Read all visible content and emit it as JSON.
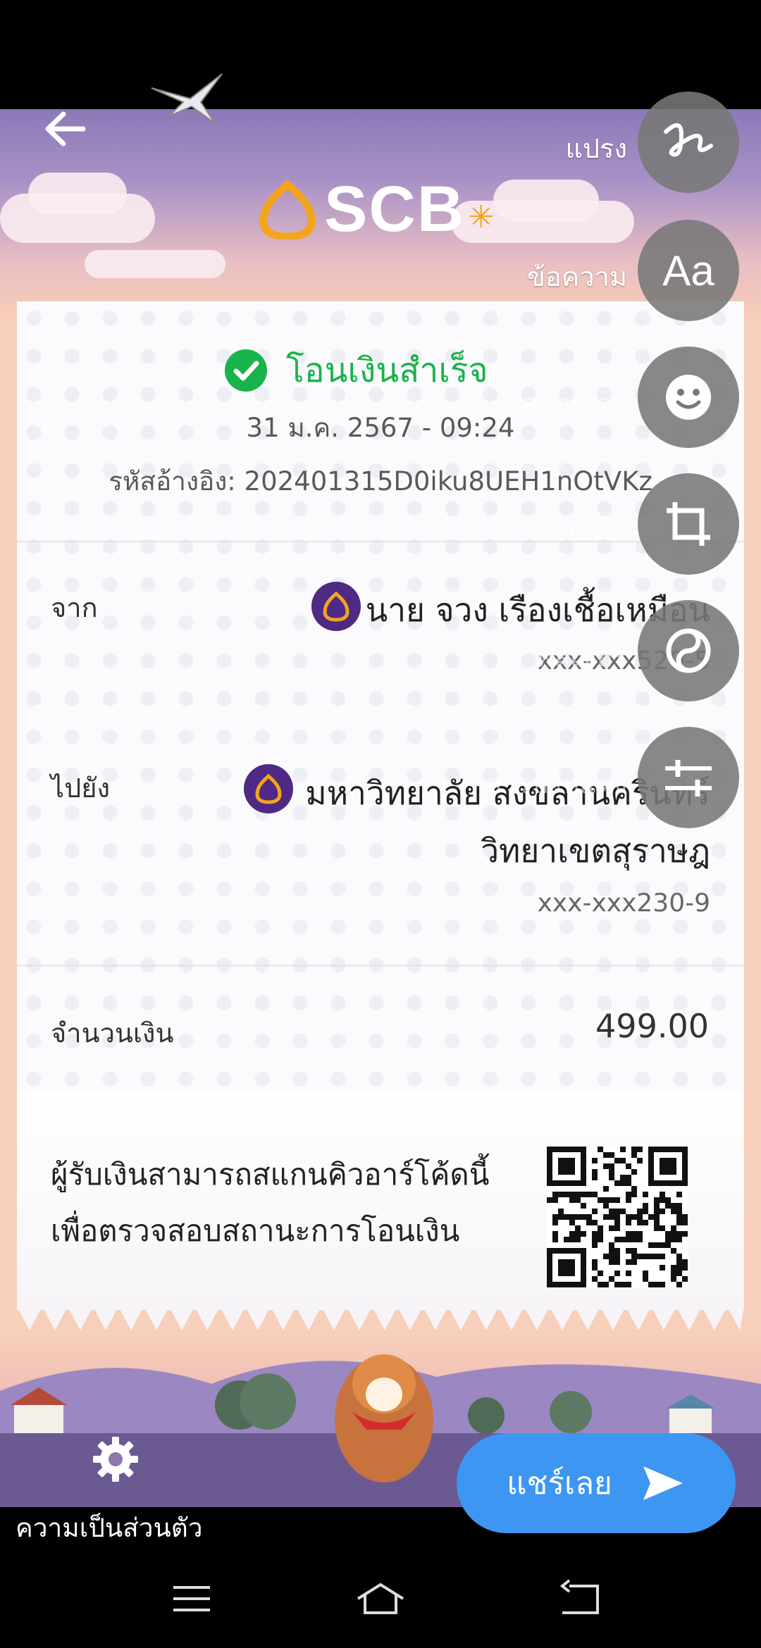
{
  "header": {
    "logo_text": "SCB"
  },
  "receipt": {
    "status": "โอนเงินสำเร็จ",
    "datetime": "31 ม.ค. 2567 - 09:24",
    "reference": "รหัสอ้างอิง: 202401315D0iku8UEH1nOtVKz",
    "from": {
      "label": "จาก",
      "name": "นาย จวง เรืองเชื้อเหมือน",
      "account": "xxx-xxx520-5"
    },
    "to": {
      "label": "ไปยัง",
      "name_line1": "มหาวิทยาลัย สงขลานครินทร์",
      "name_line2": "วิทยาเขตสุราษฎ",
      "account": "xxx-xxx230-9"
    },
    "amount": {
      "label": "จำนวนเงิน",
      "value": "499.00"
    },
    "qr_message_line1": "ผู้รับเงินสามารถสแกนคิวอาร์โค้ดนี้",
    "qr_message_line2": "เพื่อตรวจสอบสถานะการโอนเงิน"
  },
  "tools": {
    "brush": "แปรง",
    "text": "ข้อความ",
    "text_icon": "Aa",
    "sticker": "สติกเกอร์",
    "crop": "ครอบตัด",
    "filter": "ฟิลเตอร์",
    "adjust": "การปรับแต่ง"
  },
  "footer": {
    "privacy": "ความเป็นส่วนตัว",
    "share": "แชร์เลย"
  },
  "colors": {
    "success": "#18b34a",
    "share_button": "#3d96f2",
    "bank_badge": "#4e2a84",
    "logo_gold": "#f2a41f"
  },
  "icons": [
    "back-arrow-icon",
    "check-circle-icon",
    "bank-logo-icon",
    "qr-code-icon",
    "gear-icon",
    "send-icon",
    "brush-icon",
    "smiley-icon",
    "crop-icon",
    "filter-icon",
    "adjust-icon",
    "menu-icon",
    "home-icon",
    "back-icon"
  ]
}
